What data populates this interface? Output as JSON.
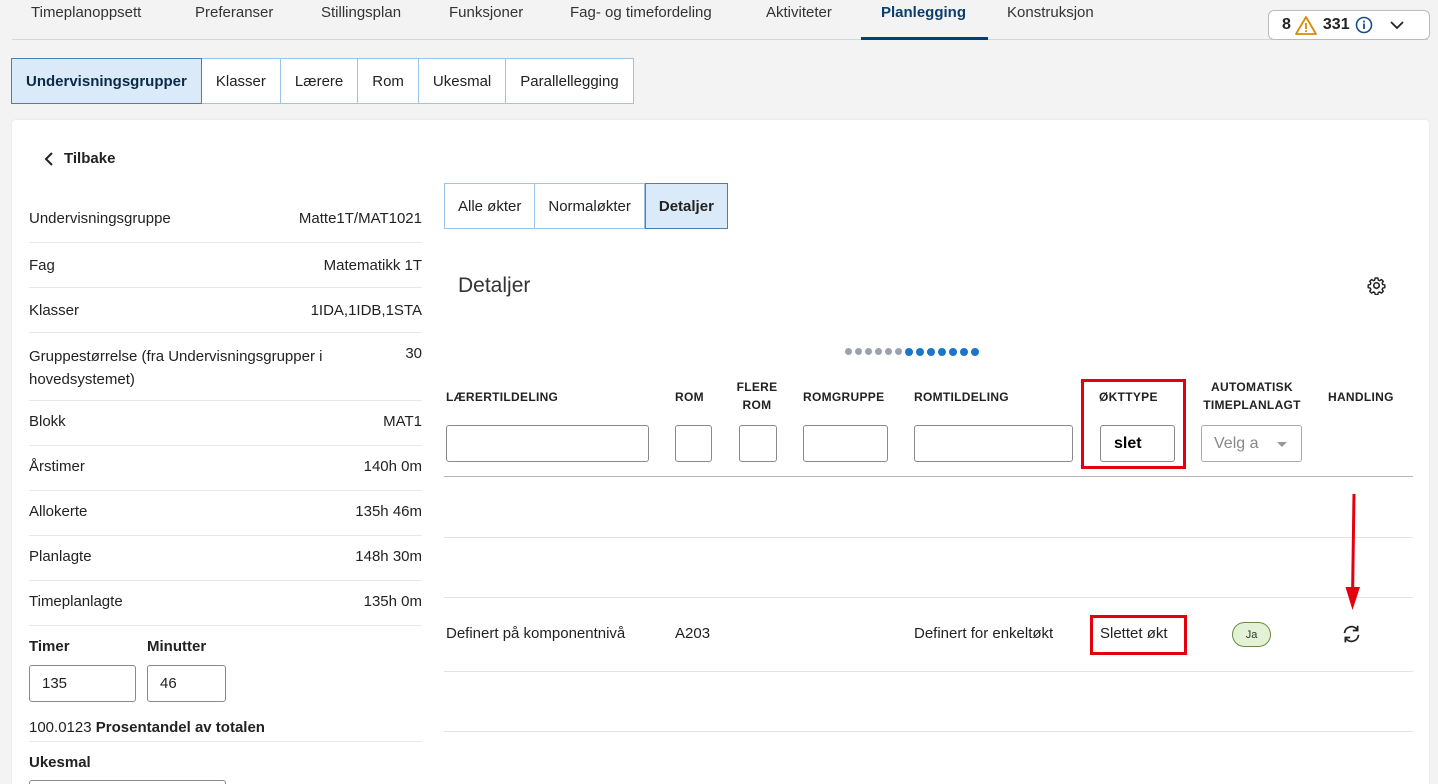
{
  "topnav": {
    "tabs": [
      "Timeplanoppsett",
      "Preferanser",
      "Stillingsplan",
      "Funksjoner",
      "Fag- og timefordeling",
      "Aktiviteter",
      "Planlegging",
      "Konstruksjon"
    ],
    "active": "Planlegging"
  },
  "alerts": {
    "warnings": "8",
    "infos": "331"
  },
  "subtabs": [
    "Undervisningsgrupper",
    "Klasser",
    "Lærere",
    "Rom",
    "Ukesmal",
    "Parallellegging"
  ],
  "back_label": "Tilbake",
  "info": [
    {
      "label": "Undervisningsgruppe",
      "value": "Matte1T/MAT1021"
    },
    {
      "label": "Fag",
      "value": "Matematikk 1T"
    },
    {
      "label": "Klasser",
      "value": "1IDA,1IDB,1STA"
    },
    {
      "label": "Gruppestørrelse (fra Undervisningsgrupper i hovedsystemet)",
      "value": "30"
    },
    {
      "label": "Blokk",
      "value": "MAT1"
    },
    {
      "label": "Årstimer",
      "value": "140h 0m"
    },
    {
      "label": "Allokerte",
      "value": "135h 46m"
    },
    {
      "label": "Planlagte",
      "value": "148h 30m"
    },
    {
      "label": "Timeplanlagte",
      "value": "135h 0m"
    }
  ],
  "time_inputs": {
    "timer_label": "Timer",
    "timer_value": "135",
    "minutter_label": "Minutter",
    "minutter_value": "46"
  },
  "percent": {
    "value": "100.0123",
    "label": "Prosentandel av totalen"
  },
  "ukesmal_label": "Ukesmal",
  "right_tabs": [
    "Alle økter",
    "Normaløkter",
    "Detaljer"
  ],
  "section_title": "Detaljer",
  "columns": {
    "laerertildeling": "LÆRERTILDELING",
    "rom": "ROM",
    "flere_rom_1": "FLERE",
    "flere_rom_2": "ROM",
    "romgruppe": "ROMGRUPPE",
    "romtildeling": "ROMTILDELING",
    "okttype": "ØKTTYPE",
    "auto_1": "AUTOMATISK",
    "auto_2": "TIMEPLANLAGT",
    "handling": "HANDLING"
  },
  "filters": {
    "okttype_value": "slet",
    "auto_placeholder": "Velg a"
  },
  "row": {
    "laerertildeling": "Definert på komponentnivå",
    "rom": "A203",
    "romtildeling": "Definert for enkeltøkt",
    "okttype": "Slettet økt",
    "auto": "Ja"
  },
  "pagination": {
    "total": 13,
    "active_from": 6
  },
  "colors": {
    "accent": "#0a3e70",
    "highlight": "#e3000f",
    "active_tab_bg": "#daeaf8"
  }
}
